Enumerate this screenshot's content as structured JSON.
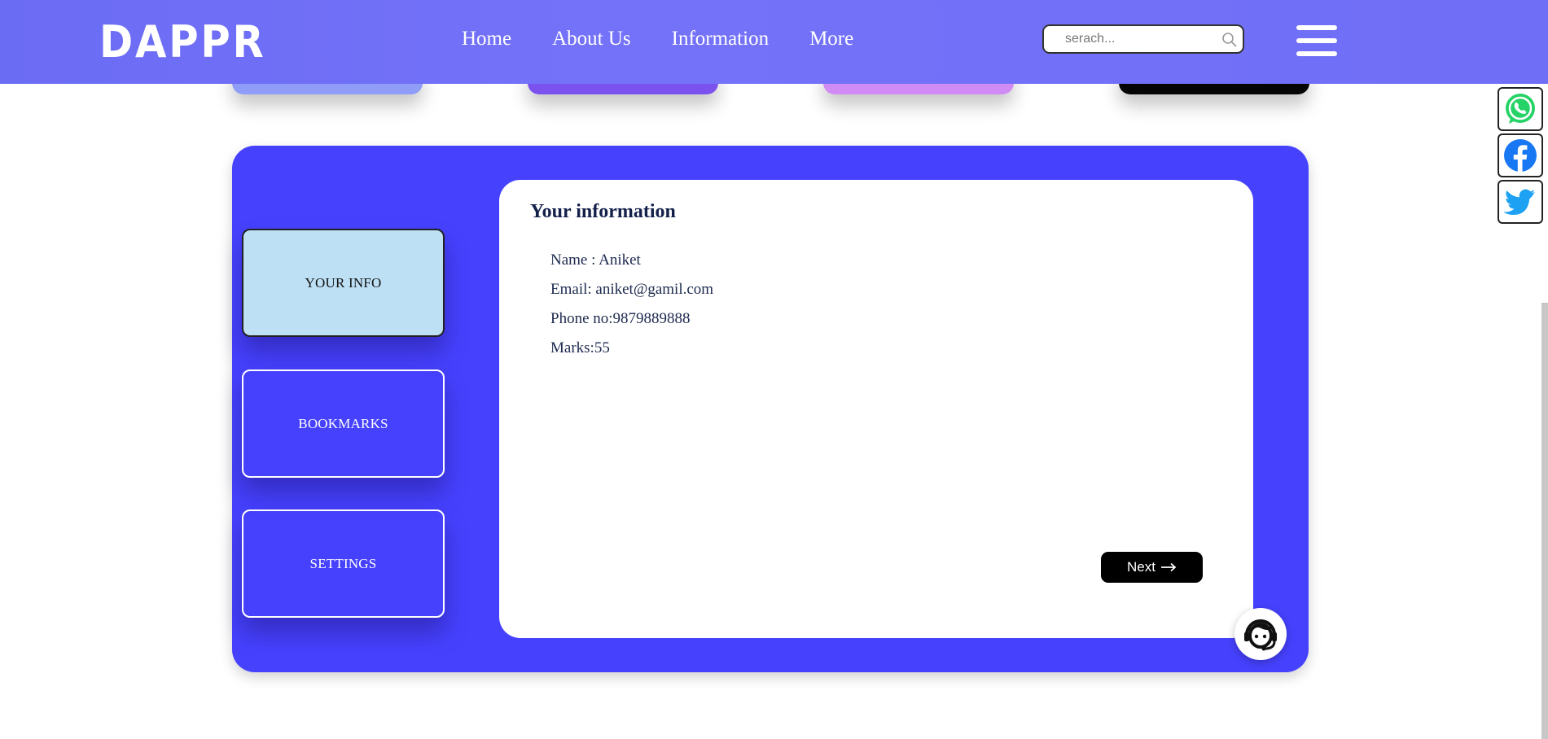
{
  "header": {
    "logo": "DAPPR",
    "nav": [
      "Home",
      "About Us",
      "Information",
      "More"
    ],
    "search_placeholder": "serach...",
    "bg_color": "#6f6ef6"
  },
  "peek_cards": [
    {
      "color": "#8f9cf8"
    },
    {
      "color": "#7b52ee"
    },
    {
      "color": "#d08cf4"
    },
    {
      "color": "#050505"
    }
  ],
  "social": [
    "whatsapp-icon",
    "facebook-icon",
    "twitter-icon"
  ],
  "sidebar": {
    "items": [
      {
        "label": "YOUR INFO",
        "active": true
      },
      {
        "label": "BOOKMARKS",
        "active": false
      },
      {
        "label": "SETTINGS",
        "active": false
      }
    ]
  },
  "info_card": {
    "title": "Your information",
    "lines": [
      "Name : Aniket",
      "Email: aniket@gamil.com",
      "Phone no:9879889888",
      "Marks:55"
    ],
    "next_label": "Next"
  },
  "colors": {
    "panel": "#4641fd",
    "active_tab": "#bde0f5"
  }
}
